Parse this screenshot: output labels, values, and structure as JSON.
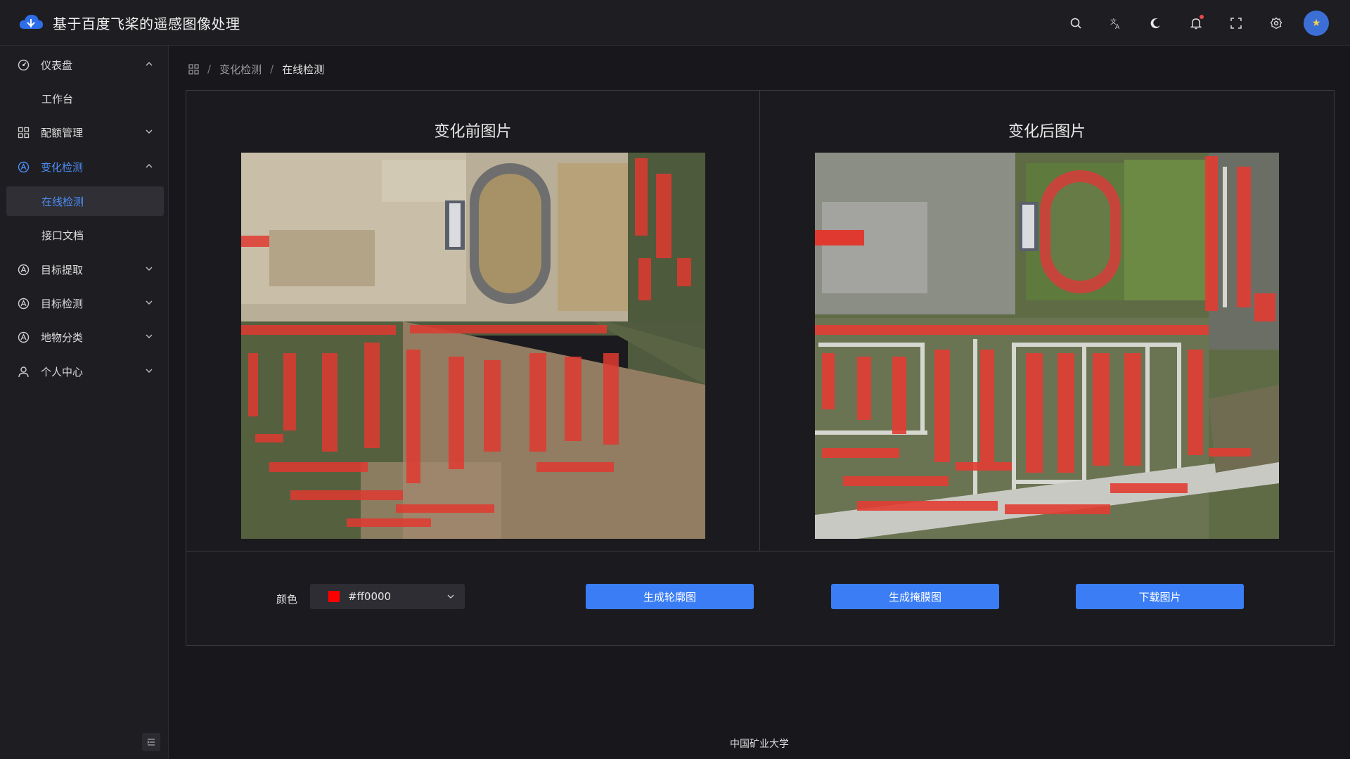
{
  "header": {
    "app_title": "基于百度飞桨的遥感图像处理",
    "icons": [
      "search-icon",
      "translate-icon",
      "dark-mode-icon",
      "bell-icon",
      "fullscreen-icon",
      "settings-icon"
    ],
    "accent_color": "#3b7df5"
  },
  "sidebar": {
    "items": [
      {
        "label": "仪表盘",
        "icon": "dashboard-icon",
        "expanded": true
      },
      {
        "label": "工作台",
        "sub": true
      },
      {
        "label": "配额管理",
        "icon": "grid-icon",
        "expanded": false
      },
      {
        "label": "变化检测",
        "icon": "change-detect-icon",
        "expanded": true,
        "active": true
      },
      {
        "label": "在线检测",
        "sub": true,
        "selected": true
      },
      {
        "label": "接口文档",
        "sub": true
      },
      {
        "label": "目标提取",
        "icon": "target-extract-icon",
        "expanded": false
      },
      {
        "label": "目标检测",
        "icon": "target-detect-icon",
        "expanded": false
      },
      {
        "label": "地物分类",
        "icon": "classify-icon",
        "expanded": false
      },
      {
        "label": "个人中心",
        "icon": "user-icon",
        "expanded": false
      }
    ]
  },
  "breadcrumb": {
    "items": [
      "变化检测",
      "在线检测"
    ],
    "separator": "/"
  },
  "panels": {
    "before_title": "变化前图片",
    "after_title": "变化后图片"
  },
  "controls": {
    "color_label": "颜色",
    "color_value": "#ff0000",
    "contour_button": "生成轮廓图",
    "mask_button": "生成掩膜图",
    "download_button": "下载图片"
  },
  "footer": {
    "text": "中国矿业大学"
  }
}
